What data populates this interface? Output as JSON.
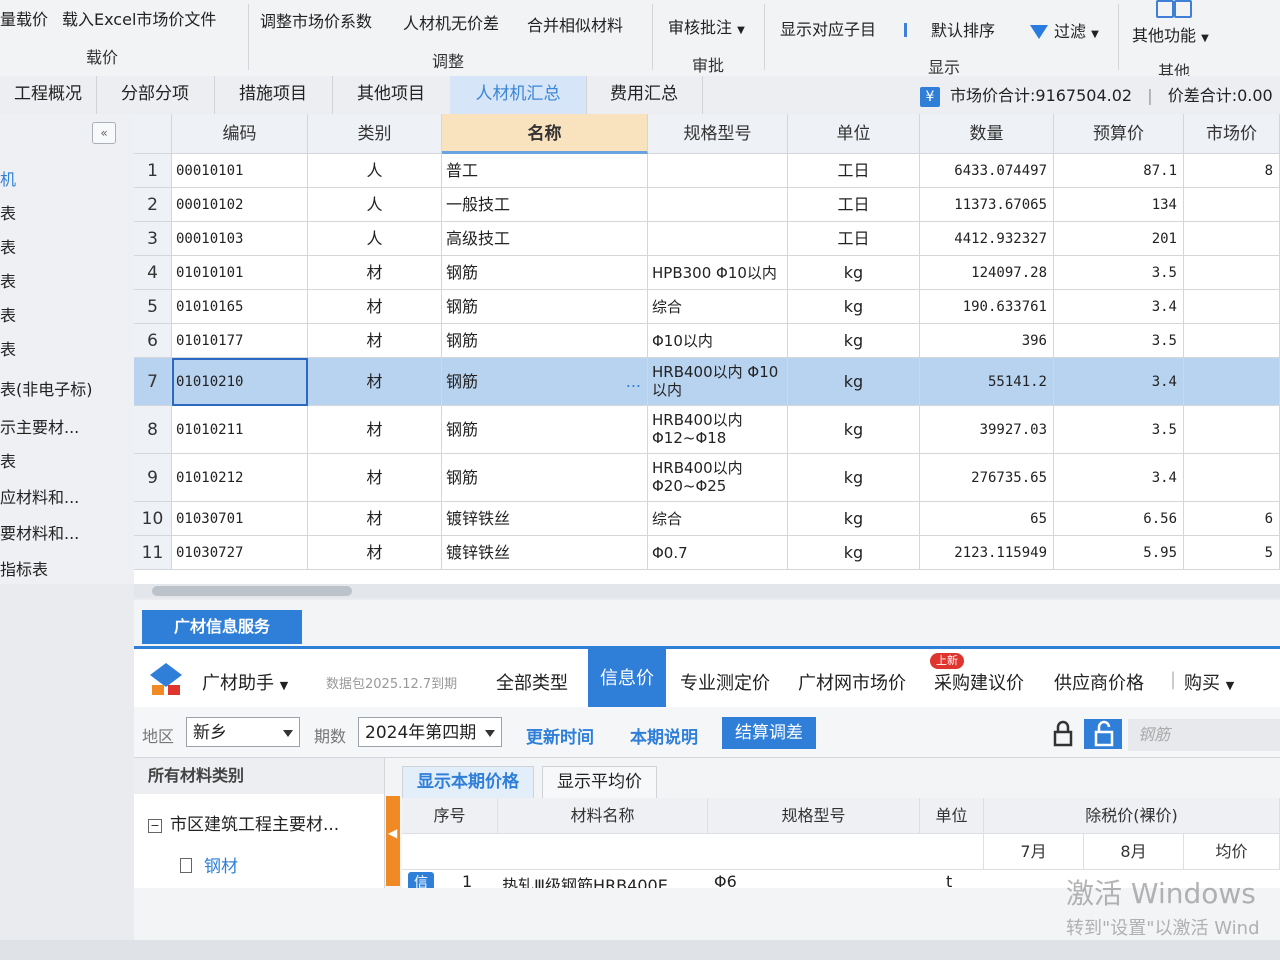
{
  "ribbon": {
    "buttons": [
      "量载价",
      "载入Excel市场价文件",
      "调整市场价系数",
      "人材机无价差",
      "合并相似材料",
      "审核批注",
      "显示对应子目",
      "默认排序",
      "过滤",
      "其他功能"
    ],
    "groups": [
      "载价",
      "调整",
      "审批",
      "显示",
      "其他"
    ]
  },
  "tabs": [
    "工程概况",
    "分部分项",
    "措施项目",
    "其他项目",
    "人材机汇总",
    "费用汇总"
  ],
  "active_tab": "人材机汇总",
  "summary": {
    "market_total": "市场价合计:9167504.02",
    "diff_total": "价差合计:0.00"
  },
  "left_panel": {
    "items": [
      "机",
      "表",
      "表",
      "表",
      "表",
      "表",
      "表(非电子标)",
      "示主要材...",
      "表",
      "应材料和...",
      "要材料和...",
      "指标表"
    ]
  },
  "grid": {
    "columns": [
      "编码",
      "类别",
      "名称",
      "规格型号",
      "单位",
      "数量",
      "预算价",
      "市场价"
    ],
    "rows": [
      {
        "no": "1",
        "code": "00010101",
        "type": "人",
        "name": "普工",
        "spec": "",
        "spec2": "",
        "unit": "工日",
        "qty": "6433.074497",
        "budget": "87.1",
        "market": "8"
      },
      {
        "no": "2",
        "code": "00010102",
        "type": "人",
        "name": "一般技工",
        "spec": "",
        "spec2": "",
        "unit": "工日",
        "qty": "11373.67065",
        "budget": "134",
        "market": ""
      },
      {
        "no": "3",
        "code": "00010103",
        "type": "人",
        "name": "高级技工",
        "spec": "",
        "spec2": "",
        "unit": "工日",
        "qty": "4412.932327",
        "budget": "201",
        "market": ""
      },
      {
        "no": "4",
        "code": "01010101",
        "type": "材",
        "name": "钢筋",
        "spec": "HPB300 Φ10以内",
        "spec2": "",
        "unit": "kg",
        "qty": "124097.28",
        "budget": "3.5",
        "market": ""
      },
      {
        "no": "5",
        "code": "01010165",
        "type": "材",
        "name": "钢筋",
        "spec": "综合",
        "spec2": "",
        "unit": "kg",
        "qty": "190.633761",
        "budget": "3.4",
        "market": ""
      },
      {
        "no": "6",
        "code": "01010177",
        "type": "材",
        "name": "钢筋",
        "spec": "Φ10以内",
        "spec2": "",
        "unit": "kg",
        "qty": "396",
        "budget": "3.5",
        "market": ""
      },
      {
        "no": "7",
        "code": "01010210",
        "type": "材",
        "name": "钢筋",
        "spec": "HRB400以内 Φ10",
        "spec2": "以内",
        "unit": "kg",
        "qty": "55141.2",
        "budget": "3.4",
        "market": ""
      },
      {
        "no": "8",
        "code": "01010211",
        "type": "材",
        "name": "钢筋",
        "spec": "HRB400以内",
        "spec2": "Φ12~Φ18",
        "unit": "kg",
        "qty": "39927.03",
        "budget": "3.5",
        "market": ""
      },
      {
        "no": "9",
        "code": "01010212",
        "type": "材",
        "name": "钢筋",
        "spec": "HRB400以内",
        "spec2": "Φ20~Φ25",
        "unit": "kg",
        "qty": "276735.65",
        "budget": "3.4",
        "market": ""
      },
      {
        "no": "10",
        "code": "01030701",
        "type": "材",
        "name": "镀锌铁丝",
        "spec": "综合",
        "spec2": "",
        "unit": "kg",
        "qty": "65",
        "budget": "6.56",
        "market": "6"
      },
      {
        "no": "11",
        "code": "01030727",
        "type": "材",
        "name": "镀锌铁丝",
        "spec": "Φ0.7",
        "spec2": "",
        "unit": "kg",
        "qty": "2123.115949",
        "budget": "5.95",
        "market": "5"
      }
    ],
    "ellipsis": "..."
  },
  "service": {
    "tab_label": "广材信息服务",
    "assistant": "广材助手",
    "data_pkg": "数据包2025.12.7到期",
    "nav": [
      "全部类型",
      "信息价",
      "专业测定价",
      "广材网市场价",
      "采购建议价",
      "供应商价格",
      "购买"
    ],
    "new_badge": "上新",
    "region_label": "地区",
    "region_value": "新乡",
    "period_label": "期数",
    "period_value": "2024年第四期",
    "update_time": "更新时间",
    "period_note": "本期说明",
    "settle_btn": "结算调差",
    "search_placeholder": "钢筋",
    "category_head": "所有材料类别",
    "category_root": "市区建筑工程主要材...",
    "category_leaf": "钢材",
    "price_tabs": [
      "显示本期价格",
      "显示平均价"
    ],
    "price_cols": [
      "序号",
      "材料名称",
      "规格型号",
      "单位",
      "除税价(裸价)"
    ],
    "months": [
      "7月",
      "8月",
      "均价"
    ],
    "first_row": {
      "badge": "信",
      "no": "1",
      "name": "热轧Ⅲ级钢筋HRB400E",
      "spec": "Φ6",
      "unit": "t"
    }
  },
  "watermark": {
    "line1": "激活 Windows",
    "line2": "转到\"设置\"以激活 Wind"
  },
  "colors": {
    "accent": "#2f7fd9",
    "name_header": "#f9e3bf",
    "selected_row": "#b8d3f0",
    "badge_red": "#e0342f"
  }
}
